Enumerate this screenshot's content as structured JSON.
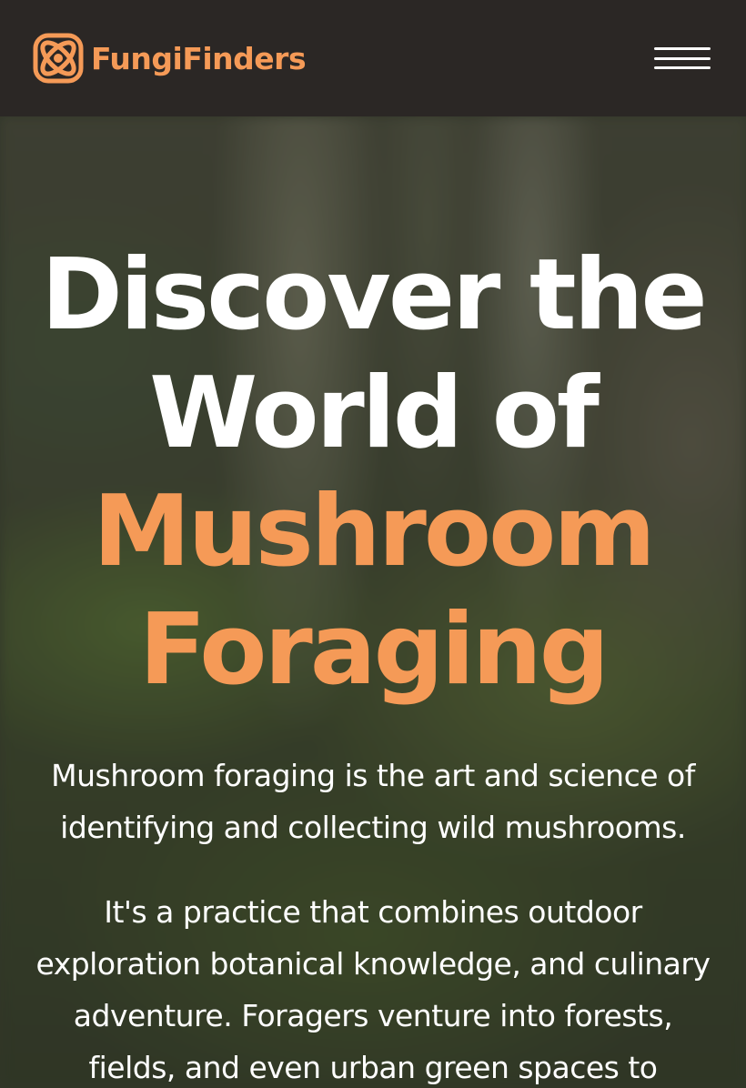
{
  "brand": {
    "name": "FungiFinders",
    "accent_color": "#f59a57",
    "logo_icon": "atom-orbit-icon"
  },
  "header": {
    "background": "#2b2725",
    "menu_icon": "hamburger-menu-icon"
  },
  "hero": {
    "headline_line_1": "Discover the",
    "headline_line_2": "World of",
    "headline_accent_1": "Mushroom",
    "headline_accent_2": "Foraging",
    "paragraph_1": "Mushroom foraging is the art and science of identifying and collecting wild mushrooms.",
    "paragraph_2": "It's a practice that combines outdoor exploration botanical knowledge, and culinary adventure. Foragers venture into forests, fields, and even urban green spaces to"
  }
}
